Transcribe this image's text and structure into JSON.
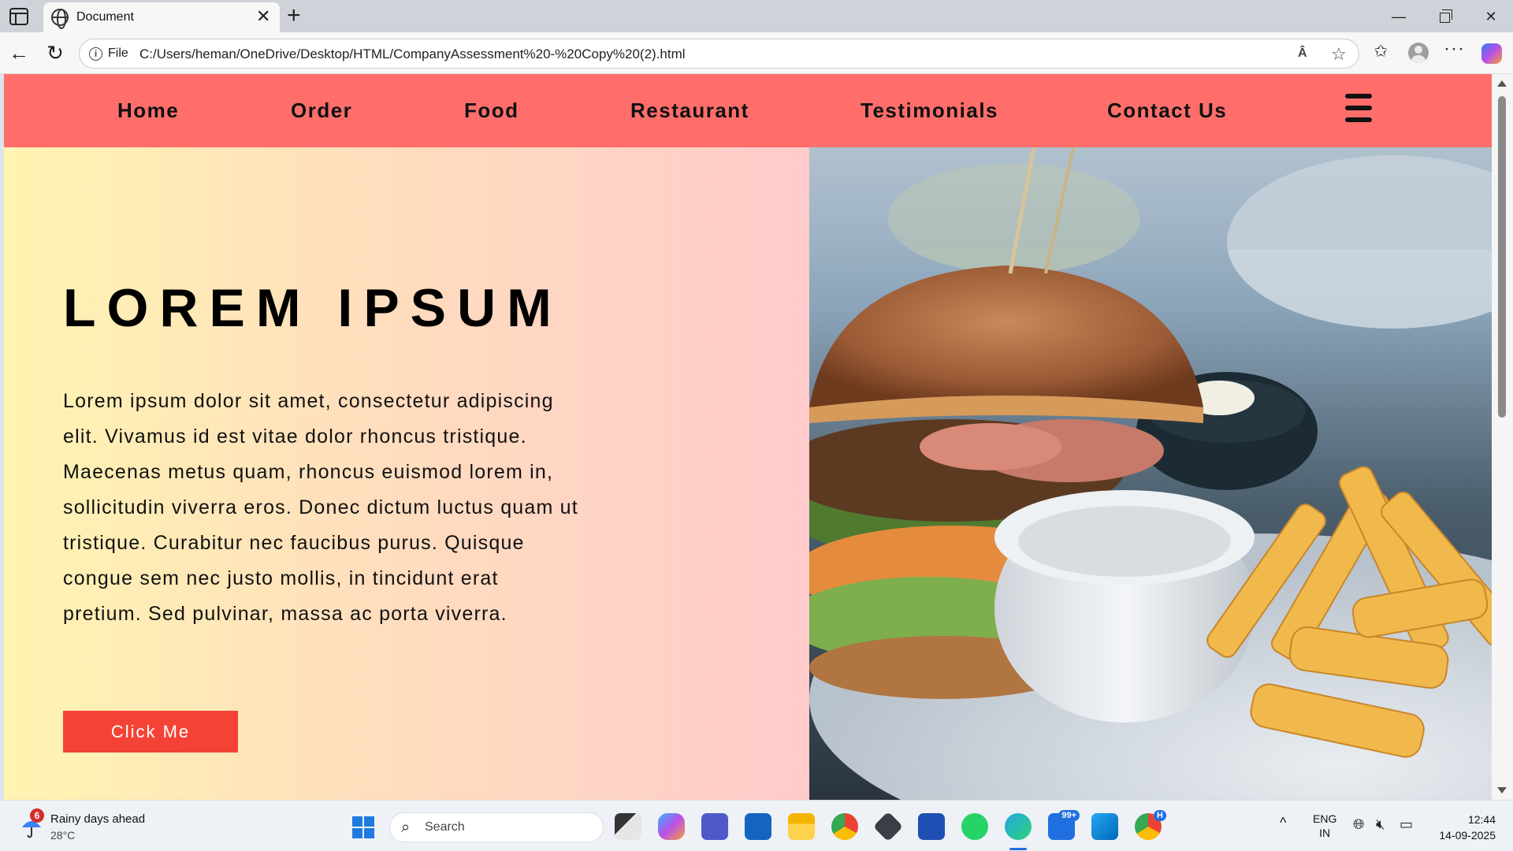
{
  "browser": {
    "tab_title": "Document",
    "file_label": "File",
    "url": "C:/Users/heman/OneDrive/Desktop/HTML/CompanyAssessment%20-%20Copy%20(2).html",
    "read_aloud_label": "Â"
  },
  "nav": {
    "links": [
      "Home",
      "Order",
      "Food",
      "Restaurant",
      "Testimonials",
      "Contact Us"
    ]
  },
  "hero": {
    "title": "LOREM IPSUM",
    "text": "Lorem ipsum dolor sit amet, consectetur adipiscing elit. Vivamus id est vitae dolor rhoncus tristique. Maecenas metus quam, rhoncus euismod lorem in, sollicitudin viverra eros. Donec dictum luctus quam ut tristique. Curabitur nec faucibus purus. Quisque congue sem nec justo mollis, in tincidunt erat pretium. Sed pulvinar, massa ac porta viverra.",
    "button_label": "Click Me",
    "image_subject": "burger-with-fries-photo"
  },
  "taskbar": {
    "weather_title": "Rainy days ahead",
    "weather_temp": "28°C",
    "weather_badge": "6",
    "search_placeholder": "Search",
    "outlook_badge": "99+",
    "chrome_badge": "H",
    "lang_line1": "ENG",
    "lang_line2": "IN",
    "time": "12:44",
    "date": "14-09-2025"
  },
  "colors": {
    "navbar": "#ff6e6a",
    "button": "#f44336",
    "gradient_start": "#fff4b2",
    "gradient_end": "#ffcbcb"
  }
}
